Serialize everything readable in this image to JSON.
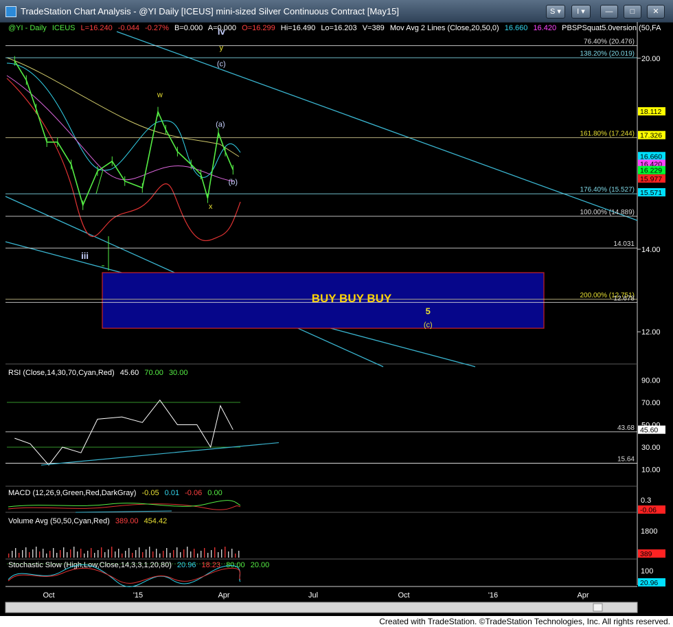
{
  "window": {
    "title": "TradeStation Chart Analysis - @YI Daily [ICEUS] mini-sized Silver Continuous Contract [May15]",
    "buttons": {
      "symbol_btn": "S",
      "info_btn": "I",
      "minimize": "—",
      "maximize": "□",
      "close": "✕"
    }
  },
  "header": {
    "symbol": "@YI - Daily",
    "exchange": "ICEUS",
    "last": "L=16.240",
    "change": "-0.044",
    "change_pct": "-0.27%",
    "bid": "B=0.000",
    "ask": "A=0.000",
    "open": "O=16.299",
    "high": "Hi=16.490",
    "low": "Lo=16.203",
    "volume": "V=389",
    "mov_avg": "Mov Avg 2 Lines (Close,20,50,0)",
    "ma_fast": "16.660",
    "ma_slow": "16.420",
    "pbs": "PBSPSquat5.0version (50,FA"
  },
  "colors": {
    "background": "#000000",
    "axis": "#cfcfcf",
    "channel": "#3ab5d0",
    "price": "#55ee44",
    "ma20": "#33d6ee",
    "ma50": "#dd66dd",
    "ma200": "#cfc96a",
    "band_low": "#e23333",
    "wave_yellow": "#e8e034",
    "wave_blue": "#c8d2ff",
    "buy_box": "#06068a",
    "buy_box_border": "#cc2222",
    "fib_cyan": "#7fd8e6",
    "fib_olive": "#c9c08a"
  },
  "chart_data": [
    {
      "type": "line",
      "title": "@YI Daily [ICEUS] mini-sized Silver Continuous Contract [May15]",
      "x_ticks": [
        "Oct",
        "'15",
        "Apr",
        "Jul",
        "Oct",
        "'16",
        "Apr"
      ],
      "y_ticks": [
        20.0,
        14.0,
        12.0
      ],
      "ylim": [
        11.3,
        21.4
      ],
      "scale": "log",
      "series": [
        {
          "name": "@YI - Daily",
          "color": "#55ee44",
          "x": [
            "2014-08-27",
            "2014-09-08",
            "2014-09-18",
            "2014-09-29",
            "2014-10-10",
            "2014-10-24",
            "2014-11-05",
            "2014-11-20",
            "2014-12-05",
            "2014-12-18",
            "2015-01-05",
            "2015-01-21",
            "2015-01-29",
            "2015-02-10",
            "2015-02-24",
            "2015-03-06",
            "2015-03-13",
            "2015-03-24",
            "2015-03-31",
            "2015-04-08"
          ],
          "y": [
            19.9,
            19.2,
            18.2,
            17.1,
            17.1,
            16.4,
            15.2,
            16.2,
            16.5,
            15.9,
            15.7,
            18.1,
            17.5,
            16.8,
            16.4,
            16.1,
            15.4,
            17.4,
            16.8,
            16.24
          ]
        }
      ],
      "horizontal_levels": [
        {
          "label": "76.40% (20.476)",
          "value": 20.476
        },
        {
          "label": "138.20% (20.019)",
          "value": 20.019
        },
        {
          "label": "161.80% (17.244)",
          "value": 17.244
        },
        {
          "label": "176.40% (15.527)",
          "value": 15.527
        },
        {
          "label": "100.00% (14.889)",
          "value": 14.889
        },
        {
          "label": "14.031",
          "value": 14.031
        },
        {
          "label": "200.00% (12.751)",
          "value": 12.751
        },
        {
          "label": "12.678",
          "value": 12.678
        }
      ],
      "price_badges": [
        {
          "label": "18.112",
          "value": 18.112,
          "bg": "#ffff00",
          "fg": "#000000"
        },
        {
          "label": "17.326",
          "value": 17.326,
          "bg": "#ffff00",
          "fg": "#000000"
        },
        {
          "label": "16.660",
          "value": 16.66,
          "bg": "#00e0ff",
          "fg": "#000000"
        },
        {
          "label": "16.420",
          "value": 16.42,
          "bg": "#ff44ff",
          "fg": "#000000"
        },
        {
          "label": "16.229",
          "value": 16.229,
          "bg": "#00ff33",
          "fg": "#000000"
        },
        {
          "label": "15.977",
          "value": 15.977,
          "bg": "#ff2222",
          "fg": "#000000"
        },
        {
          "label": "15.571",
          "value": 15.571,
          "bg": "#00e0ff",
          "fg": "#000000"
        }
      ],
      "wave_labels": [
        {
          "label": "iv",
          "x": "2015-03-27",
          "y": 20.9,
          "color": "#c8d2ff"
        },
        {
          "label": "y",
          "x": "2015-03-27",
          "y": 20.3,
          "color": "#e8e034"
        },
        {
          "label": "(c)",
          "x": "2015-03-27",
          "y": 19.7,
          "color": "#c8d2ff"
        },
        {
          "label": "w",
          "x": "2015-01-23",
          "y": 18.6,
          "color": "#e8e034"
        },
        {
          "label": "(a)",
          "x": "2015-03-26",
          "y": 17.6,
          "color": "#c8d2ff"
        },
        {
          "label": "(b)",
          "x": "2015-04-08",
          "y": 15.8,
          "color": "#c8d2ff"
        },
        {
          "label": "x",
          "x": "2015-03-16",
          "y": 15.1,
          "color": "#e8e034"
        },
        {
          "label": "iii",
          "x": "2014-11-07",
          "y": 13.75,
          "color": "#c8d2ff"
        },
        {
          "label": "5",
          "x": "2015-10-25",
          "y": 12.4,
          "color": "#e8e034"
        },
        {
          "label": "(c)",
          "x": "2015-10-25",
          "y": 12.1,
          "color": "#e8e034"
        }
      ],
      "annotations": [
        {
          "label": "BUY BUY BUY",
          "x_range": [
            "2014-11-01",
            "2015-12-03"
          ],
          "y_range": [
            12.55,
            13.9
          ]
        }
      ]
    },
    {
      "type": "line",
      "title": "RSI (Close,14,30,70,Cyan,Red)",
      "values_text": [
        "45.60",
        "70.00",
        "30.00"
      ],
      "y_ticks": [
        90.0,
        70.0,
        50.0,
        30.0,
        10.0
      ],
      "ylim": [
        0,
        100
      ],
      "series": [
        {
          "name": "RSI",
          "color": "#ffffff",
          "x": [
            "2014-08-27",
            "2014-09-12",
            "2014-10-01",
            "2014-10-15",
            "2014-11-03",
            "2014-11-20",
            "2014-12-15",
            "2015-01-05",
            "2015-01-23",
            "2015-02-10",
            "2015-03-02",
            "2015-03-16",
            "2015-03-26",
            "2015-04-08"
          ],
          "y": [
            38,
            33,
            14,
            30,
            25,
            55,
            57,
            52,
            72,
            50,
            50,
            30,
            67,
            45.6
          ]
        }
      ],
      "levels": [
        {
          "label": "43.68",
          "value": 43.68
        },
        {
          "label": "15.64",
          "value": 15.64
        }
      ],
      "badges": [
        {
          "label": "45.60",
          "value": 45.6,
          "bg": "#ffffff",
          "fg": "#000000"
        }
      ]
    },
    {
      "type": "line",
      "title": "MACD (12,26,9,Green,Red,DarkGray)",
      "values_text": [
        "-0.05",
        "0.01",
        "-0.06",
        "0.00"
      ],
      "y_ticks": [
        0.3
      ],
      "badges": [
        {
          "label": "-0.06",
          "value": -0.06,
          "bg": "#ff2222",
          "fg": "#000000"
        }
      ]
    },
    {
      "type": "bar",
      "title": "Volume Avg (50,50,Cyan,Red)",
      "values_text": [
        "389.00",
        "454.42"
      ],
      "y_ticks": [
        1800
      ],
      "badges": [
        {
          "label": "389",
          "value": 389,
          "bg": "#ff2222",
          "fg": "#000000"
        }
      ]
    },
    {
      "type": "line",
      "title": "Stochastic Slow (High,Low,Close,14,3,3,1,20,80)",
      "values_text": [
        "20.96",
        "18.23",
        "80.00",
        "20.00"
      ],
      "y_ticks": [
        100.0
      ],
      "badges": [
        {
          "label": "20.96",
          "value": 20.96,
          "bg": "#00e0ff",
          "fg": "#000000"
        }
      ]
    }
  ],
  "footer": {
    "credit": "Created with TradeStation. ©TradeStation Technologies, Inc. All rights reserved."
  }
}
